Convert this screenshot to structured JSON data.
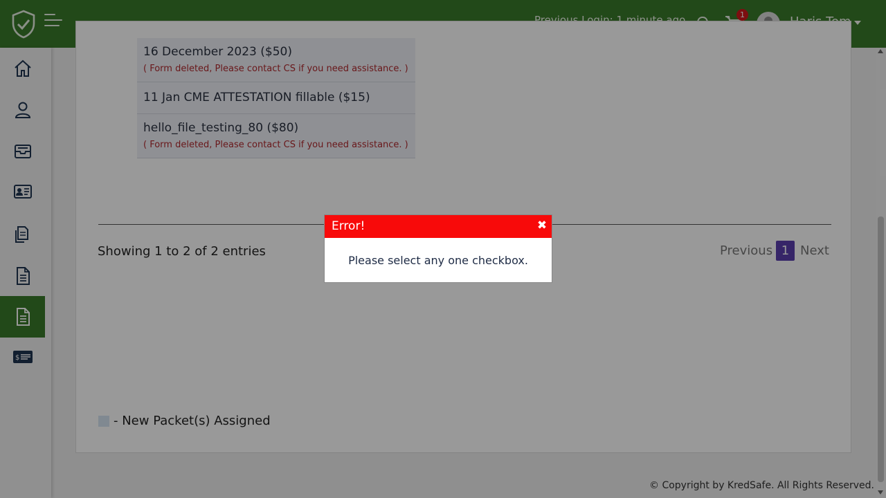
{
  "header": {
    "previous_login": "Previous Login: 1 minute ago",
    "cart_count": "1",
    "username": "Haris Tom"
  },
  "sidebar": {
    "items": [
      {
        "icon": "home-icon"
      },
      {
        "icon": "user-icon"
      },
      {
        "icon": "inbox-icon"
      },
      {
        "icon": "id-card-icon"
      },
      {
        "icon": "documents-icon"
      },
      {
        "icon": "document-icon"
      },
      {
        "icon": "document-active-icon",
        "active": true
      },
      {
        "icon": "payment-card-icon"
      }
    ]
  },
  "packets": [
    {
      "name": "16 December 2023 ($50)",
      "note": "( Form deleted, Please contact CS if you need assistance. )"
    },
    {
      "name": "11 Jan CME ATTESTATION fillable ($15)",
      "note": ""
    },
    {
      "name": "hello_file_testing_80 ($80)",
      "note": "( Form deleted, Please contact CS if you need assistance. )"
    }
  ],
  "table_info": {
    "showing": "Showing 1 to 2 of 2 entries",
    "previous": "Previous",
    "page": "1",
    "next": "Next"
  },
  "legend": {
    "text": "- New Packet(s) Assigned"
  },
  "footer": {
    "copyright": "© Copyright by KredSafe. All Rights Reserved."
  },
  "modal": {
    "title": "Error!",
    "close_symbol": "✖",
    "message": "Please select any one checkbox."
  },
  "colors": {
    "brand_green": "#3a7a2a",
    "error_red": "#f80a0a",
    "pager_active": "#5b3fae",
    "deleted_note": "#b0282d"
  }
}
